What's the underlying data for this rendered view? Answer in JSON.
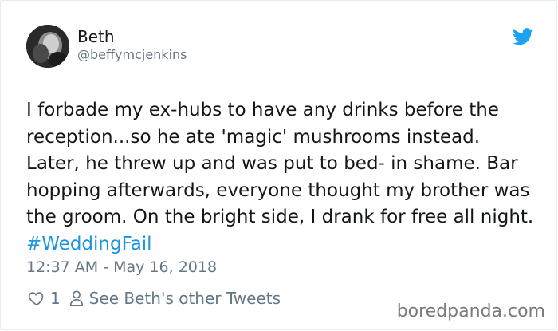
{
  "tweet": {
    "author": {
      "display_name": "Beth",
      "handle": "@beffymcjenkins"
    },
    "text_before_hashtag": "I forbade my ex-hubs to have any drinks before the reception...so he ate 'magic' mushrooms instead. Later, he threw up and was put to bed- in shame. Bar hopping afterwards, everyone thought my brother was the groom. On the bright side, I drank for free all night. ",
    "hashtag": "#WeddingFail",
    "timestamp": "12:37 AM - May 16, 2018",
    "like_count": "1",
    "profile_link": "See Beth's other Tweets"
  },
  "icons": {
    "brand": "twitter-bird-icon",
    "like": "heart-icon",
    "profile": "user-icon"
  },
  "watermark": "boredpanda.com",
  "colors": {
    "twitter_blue": "#1da1f2",
    "hashtag": "#1b95e0",
    "muted": "#657786",
    "text": "#14171a"
  }
}
